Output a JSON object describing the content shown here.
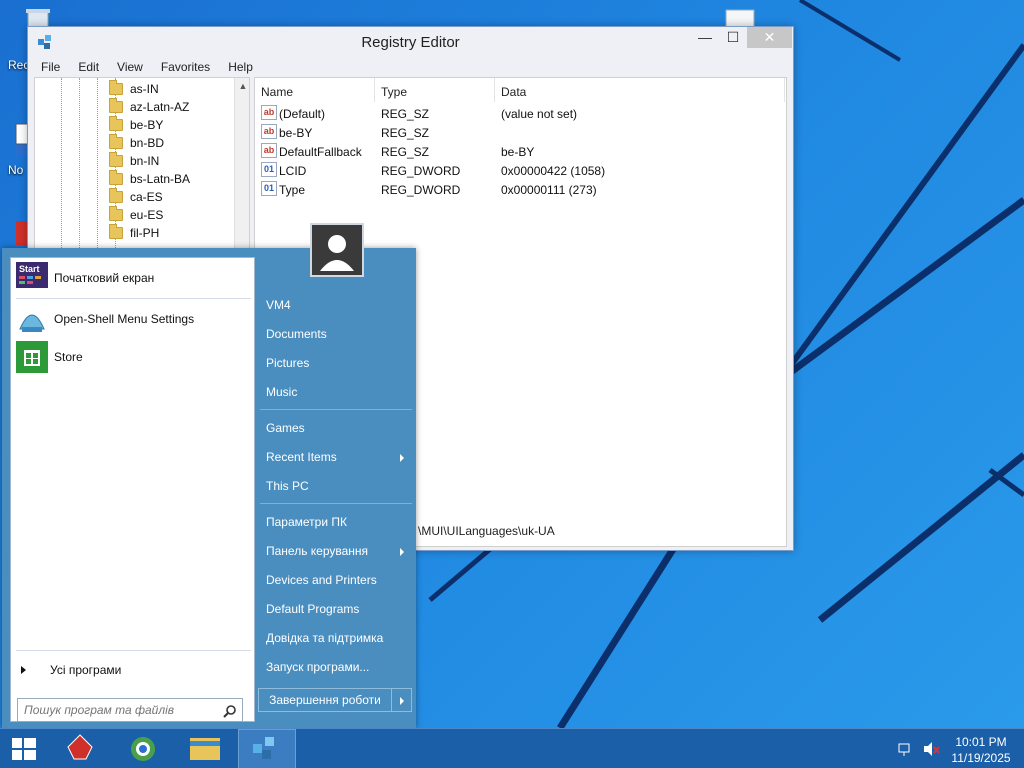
{
  "desktop": {
    "icons": [
      {
        "label": "Rec"
      },
      {
        "label": "No"
      }
    ]
  },
  "regedit": {
    "title": "Registry Editor",
    "window_buttons": {
      "minimize": "—",
      "maximize": "☐",
      "close": "✕"
    },
    "menu": [
      "File",
      "Edit",
      "View",
      "Favorites",
      "Help"
    ],
    "tree_items": [
      "as-IN",
      "az-Latn-AZ",
      "be-BY",
      "bn-BD",
      "bn-IN",
      "bs-Latn-BA",
      "ca-ES",
      "eu-ES",
      "fil-PH"
    ],
    "columns": {
      "name": "Name",
      "type": "Type",
      "data": "Data"
    },
    "values": [
      {
        "name": "(Default)",
        "type": "REG_SZ",
        "data": "(value not set)",
        "icon": "string-value-icon"
      },
      {
        "name": "be-BY",
        "type": "REG_SZ",
        "data": "",
        "icon": "string-value-icon"
      },
      {
        "name": "DefaultFallback",
        "type": "REG_SZ",
        "data": "be-BY",
        "icon": "string-value-icon"
      },
      {
        "name": "LCID",
        "type": "REG_DWORD",
        "data": "0x00000422 (1058)",
        "icon": "binary-value-icon"
      },
      {
        "name": "Type",
        "type": "REG_DWORD",
        "data": "0x00000111 (273)",
        "icon": "binary-value-icon"
      }
    ],
    "status_path": "\\MUI\\UILanguages\\uk-UA"
  },
  "startmenu": {
    "pinned": [
      {
        "label": "Початковий екран",
        "icon_text": "Start"
      },
      {
        "label": "Open-Shell Menu Settings"
      },
      {
        "label": "Store"
      }
    ],
    "all_programs": "Усі програми",
    "search_placeholder": "Пошук програм та файлів",
    "right_items": [
      {
        "label": "VM4"
      },
      {
        "label": "Documents"
      },
      {
        "label": "Pictures"
      },
      {
        "label": "Music"
      },
      {
        "label": "Games"
      },
      {
        "label": "Recent Items",
        "submenu": true
      },
      {
        "label": "This PC"
      },
      {
        "label": "Параметри ПК"
      },
      {
        "label": "Панель керування",
        "submenu": true
      },
      {
        "label": "Devices and Printers"
      },
      {
        "label": "Default Programs"
      },
      {
        "label": "Довідка та підтримка"
      },
      {
        "label": "Запуск програми..."
      }
    ],
    "shutdown": "Завершення роботи"
  },
  "taskbar": {
    "time": "10:01 PM",
    "date": "11/19/2025"
  },
  "colors": {
    "desktop": "#1e7fd8",
    "startmenu": "#4a8ec0",
    "taskbar": "#1a5fa8"
  }
}
